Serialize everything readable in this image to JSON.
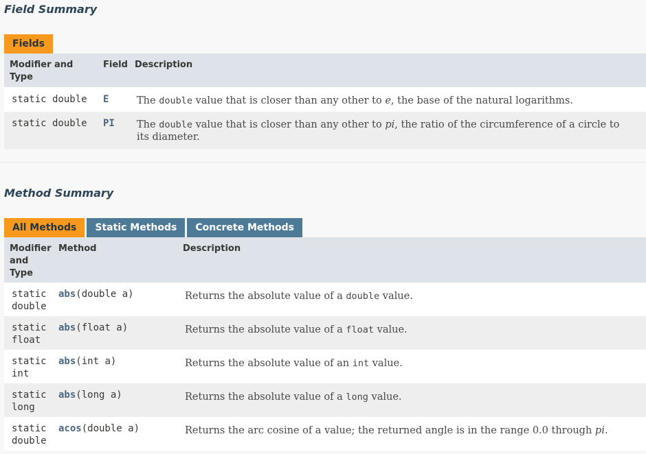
{
  "field_summary": {
    "heading": "Field Summary",
    "tab": "Fields",
    "headers": {
      "modifier": "Modifier and Type",
      "field": "Field",
      "description": "Description"
    },
    "rows": [
      {
        "modifier": "static double",
        "field": "E",
        "desc_pre": "The ",
        "desc_code": "double",
        "desc_mid": " value that is closer than any other to ",
        "desc_em": "e",
        "desc_post": ", the base of the natural logarithms."
      },
      {
        "modifier": "static double",
        "field": "PI",
        "desc_pre": "The ",
        "desc_code": "double",
        "desc_mid": " value that is closer than any other to ",
        "desc_em": "pi",
        "desc_post": ", the ratio of the circumference of a circle to its diameter."
      }
    ]
  },
  "method_summary": {
    "heading": "Method Summary",
    "tabs": [
      "All Methods",
      "Static Methods",
      "Concrete Methods"
    ],
    "headers": {
      "modifier": "Modifier and Type",
      "method": "Method",
      "description": "Description"
    },
    "rows": [
      {
        "mod1": "static",
        "mod2": "double",
        "name": "abs",
        "params": "(double a)",
        "desc_pre": "Returns the absolute value of a ",
        "desc_code": "double",
        "desc_post": " value."
      },
      {
        "mod1": "static",
        "mod2": "float",
        "name": "abs",
        "params": "(float a)",
        "desc_pre": "Returns the absolute value of a ",
        "desc_code": "float",
        "desc_post": " value."
      },
      {
        "mod1": "static",
        "mod2": "int",
        "name": "abs",
        "params": "(int a)",
        "desc_pre": "Returns the absolute value of an ",
        "desc_code": "int",
        "desc_post": " value."
      },
      {
        "mod1": "static",
        "mod2": "long",
        "name": "abs",
        "params": "(long a)",
        "desc_pre": "Returns the absolute value of a ",
        "desc_code": "long",
        "desc_post": " value."
      },
      {
        "mod1": "static",
        "mod2": "double",
        "name": "acos",
        "params": "(double a)",
        "desc_pre": "Returns the arc cosine of a value; the returned angle is in the range 0.0 through ",
        "desc_em": "pi",
        "desc_post": "."
      }
    ]
  }
}
